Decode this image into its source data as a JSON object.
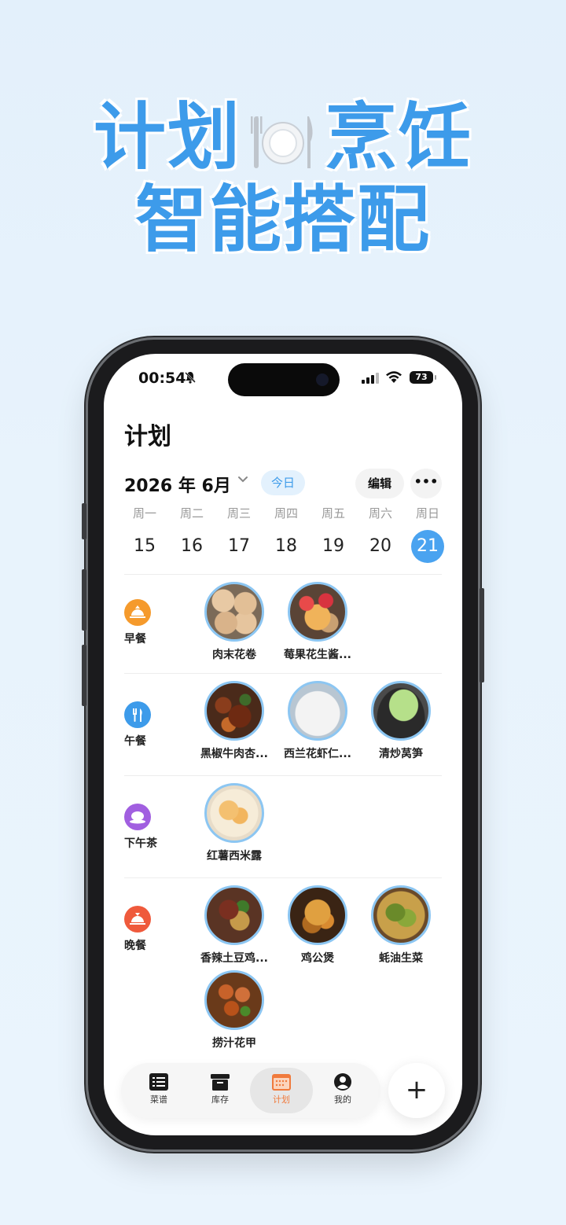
{
  "promo": {
    "line1_left": "计划",
    "line1_right": "烹饪",
    "line2": "智能搭配"
  },
  "status_bar": {
    "time": "00:54",
    "battery": "73"
  },
  "header": {
    "title": "计划",
    "month": "2026 年 6月",
    "today_label": "今日",
    "edit_label": "编辑",
    "more_label": "•••"
  },
  "week": {
    "days": [
      {
        "weekday": "周一",
        "date": "15"
      },
      {
        "weekday": "周二",
        "date": "16"
      },
      {
        "weekday": "周三",
        "date": "17"
      },
      {
        "weekday": "周四",
        "date": "18"
      },
      {
        "weekday": "周五",
        "date": "19"
      },
      {
        "weekday": "周六",
        "date": "20"
      },
      {
        "weekday": "周日",
        "date": "21"
      }
    ],
    "selected_date": "21"
  },
  "meals": [
    {
      "label": "早餐",
      "icon": "sunrise-icon",
      "color": "#f59a2c",
      "dishes": [
        "肉末花卷",
        "莓果花生酱..."
      ]
    },
    {
      "label": "午餐",
      "icon": "fork-knife-icon",
      "color": "#3d9bea",
      "dishes": [
        "黑椒牛肉杏...",
        "西兰花虾仁...",
        "清炒莴笋"
      ]
    },
    {
      "label": "下午茶",
      "icon": "teacup-icon",
      "color": "#a15fe0",
      "dishes": [
        "红薯西米露"
      ]
    },
    {
      "label": "晚餐",
      "icon": "sunset-icon",
      "color": "#ef5a3c",
      "dishes": [
        "香辣土豆鸡...",
        "鸡公煲",
        "蚝油生菜",
        "捞汁花甲"
      ]
    }
  ],
  "tabbar": {
    "tabs": [
      {
        "label": "菜谱",
        "icon": "recipe-icon"
      },
      {
        "label": "库存",
        "icon": "inventory-icon"
      },
      {
        "label": "计划",
        "icon": "calendar-icon"
      },
      {
        "label": "我的",
        "icon": "profile-icon"
      }
    ],
    "active": "计划",
    "add_label": "+"
  },
  "colors": {
    "accent": "#3d9bea",
    "active_tab": "#f07a3c"
  }
}
